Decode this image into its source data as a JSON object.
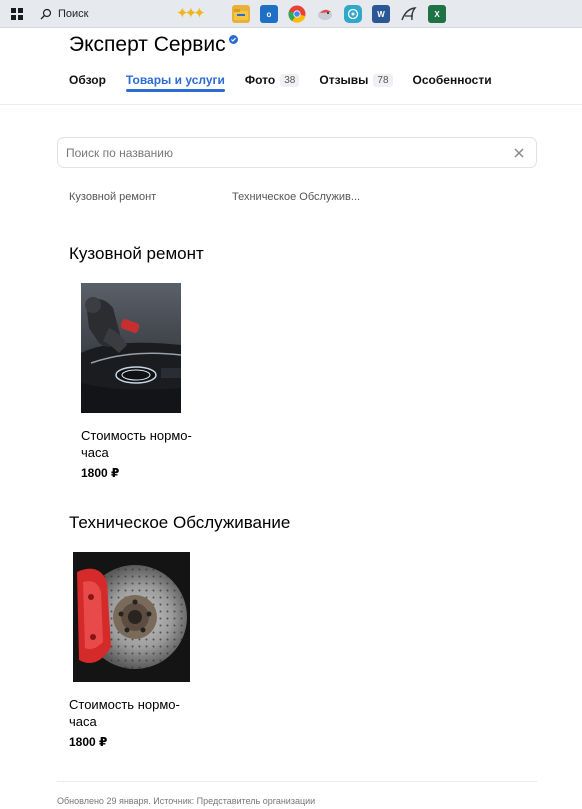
{
  "taskbar": {
    "search_label": "Поиск",
    "icons": [
      {
        "name": "file-explorer-icon",
        "color": "#e8b13a",
        "glyph": ""
      },
      {
        "name": "outlook-icon",
        "color": "#1f6fc5",
        "glyph": "o"
      },
      {
        "name": "chrome-icon",
        "color": "#e94235",
        "glyph": ""
      },
      {
        "name": "bird-app-icon",
        "color": "#d9dde3",
        "glyph": ""
      },
      {
        "name": "app-icon",
        "color": "#2fa8c9",
        "glyph": ""
      },
      {
        "name": "word-icon",
        "color": "#2b5797",
        "glyph": "W"
      },
      {
        "name": "pen-app-icon",
        "color": "#e6e9ee",
        "glyph": ""
      },
      {
        "name": "excel-icon",
        "color": "#1f7244",
        "glyph": "X"
      }
    ]
  },
  "org": {
    "title": "Эксперт Сервис",
    "verified_color": "#2a6bd4"
  },
  "tabs": [
    {
      "label": "Обзор",
      "count": ""
    },
    {
      "label": "Товары и услуги",
      "count": ""
    },
    {
      "label": "Фото",
      "count": "38"
    },
    {
      "label": "Отзывы",
      "count": "78"
    },
    {
      "label": "Особенности",
      "count": ""
    }
  ],
  "search": {
    "placeholder": "Поиск по названию",
    "value": ""
  },
  "categories": [
    "Кузовной ремонт",
    "Техническое Обслужив..."
  ],
  "sections": [
    {
      "title": "Кузовной ремонт",
      "products": [
        {
          "name": "Стоимость нормо-часа",
          "price": "1800 ₽",
          "image": "car-polishing-photo"
        }
      ]
    },
    {
      "title": "Техническое Обслуживание",
      "products": [
        {
          "name": "Стоимость нормо-часа",
          "price": "1800 ₽",
          "image": "brake-disc-photo"
        }
      ]
    }
  ],
  "footer": {
    "text": "Обновлено 29 января. Источник: Представитель организации"
  },
  "colors": {
    "accent": "#2a6bd4",
    "background": "#ffffff"
  }
}
